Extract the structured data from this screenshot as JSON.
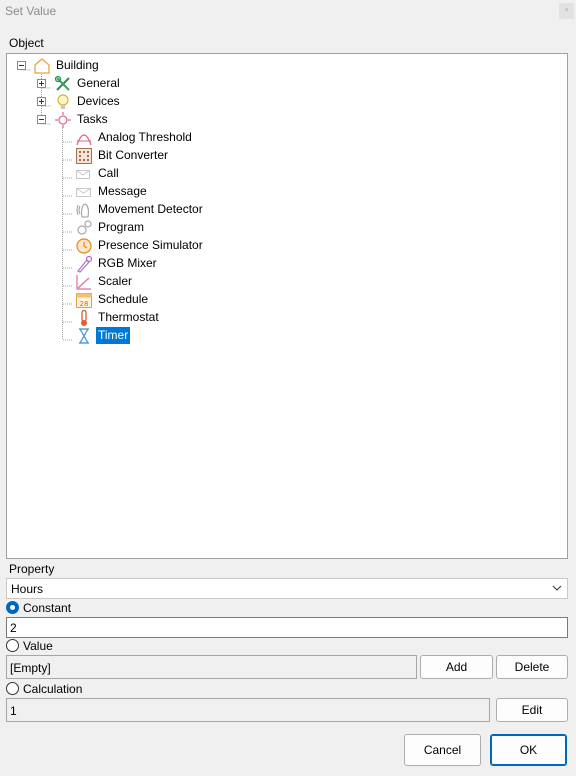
{
  "window": {
    "title": "Set Value",
    "close_glyph": "▫"
  },
  "object_label": "Object",
  "tree": {
    "root": {
      "label": "Building",
      "icon": "house-icon"
    },
    "children": [
      {
        "label": "General",
        "icon": "tools-icon"
      },
      {
        "label": "Devices",
        "icon": "lightbulb-icon"
      },
      {
        "label": "Tasks",
        "icon": "gear-icon"
      }
    ],
    "tasks": [
      {
        "label": "Analog Threshold",
        "icon": "analog-threshold-icon"
      },
      {
        "label": "Bit Converter",
        "icon": "bit-converter-icon"
      },
      {
        "label": "Call",
        "icon": "call-icon"
      },
      {
        "label": "Message",
        "icon": "message-icon"
      },
      {
        "label": "Movement Detector",
        "icon": "movement-detector-icon"
      },
      {
        "label": "Program",
        "icon": "program-icon"
      },
      {
        "label": "Presence Simulator",
        "icon": "presence-simulator-icon"
      },
      {
        "label": "RGB Mixer",
        "icon": "rgb-mixer-icon"
      },
      {
        "label": "Scaler",
        "icon": "scaler-icon"
      },
      {
        "label": "Schedule",
        "icon": "schedule-icon"
      },
      {
        "label": "Thermostat",
        "icon": "thermostat-icon"
      },
      {
        "label": "Timer",
        "icon": "timer-icon",
        "selected": true
      }
    ]
  },
  "property": {
    "label": "Property",
    "selected": "Hours"
  },
  "constant": {
    "label": "Constant",
    "value": "2",
    "checked": true
  },
  "value": {
    "label": "Value",
    "value": "[Empty]",
    "add_label": "Add",
    "delete_label": "Delete"
  },
  "calculation": {
    "label": "Calculation",
    "value": "1",
    "edit_label": "Edit"
  },
  "footer": {
    "cancel_label": "Cancel",
    "ok_label": "OK"
  },
  "colors": {
    "selection": "#0078d7",
    "accent": "#0067c0"
  }
}
